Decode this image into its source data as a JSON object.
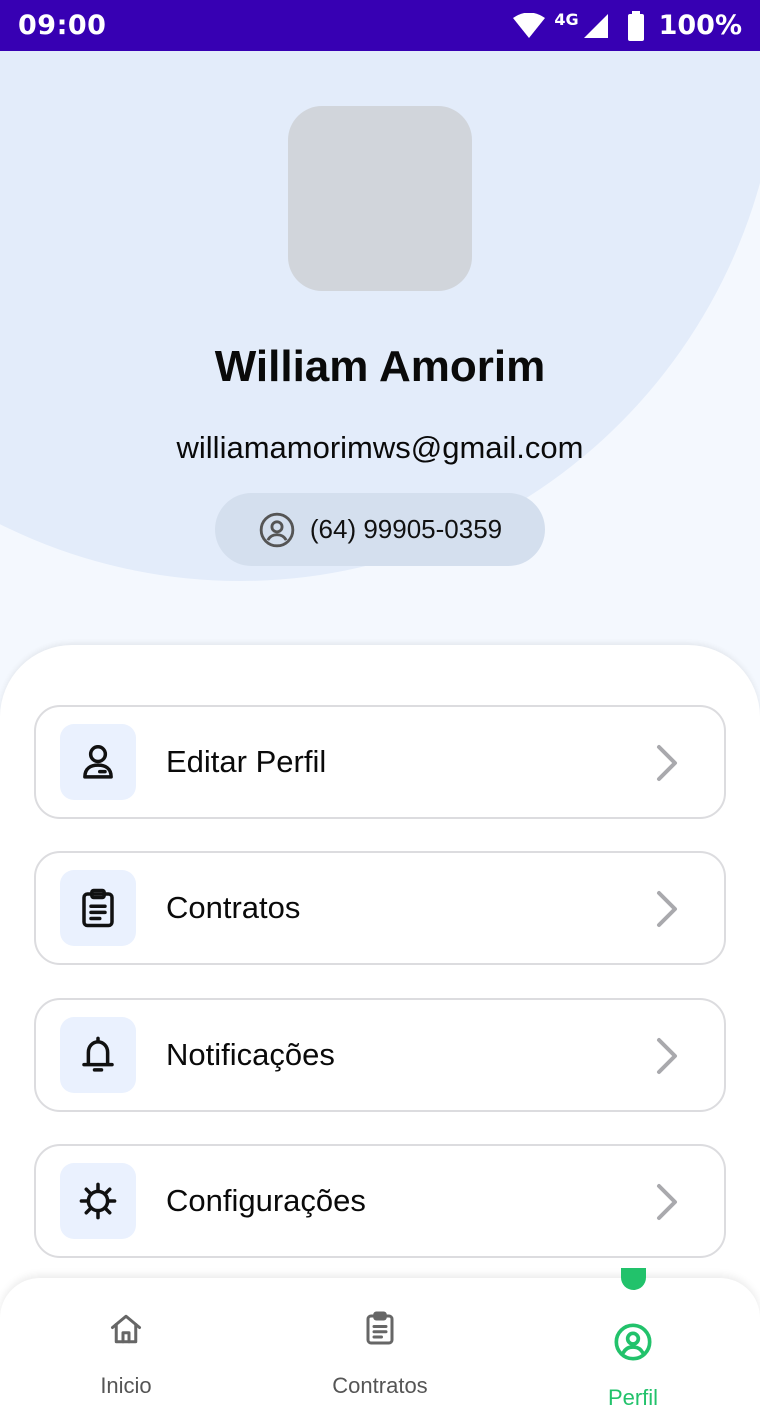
{
  "status_bar": {
    "time": "09:00",
    "network": "4G",
    "battery": "100%"
  },
  "profile": {
    "name": "William Amorim",
    "email": "williamamorimws@gmail.com",
    "phone": "(64) 99905-0359"
  },
  "menu": {
    "items": [
      {
        "label": "Editar Perfil",
        "icon": "user-icon"
      },
      {
        "label": "Contratos",
        "icon": "clipboard-icon"
      },
      {
        "label": "Notificações",
        "icon": "bell-icon"
      },
      {
        "label": "Configurações",
        "icon": "gear-icon"
      }
    ]
  },
  "bottom_nav": {
    "items": [
      {
        "label": "Inicio",
        "icon": "home-icon"
      },
      {
        "label": "Contratos",
        "icon": "clipboard-icon"
      },
      {
        "label": "Perfil",
        "icon": "user-circle-icon"
      }
    ],
    "active_index": 2,
    "active_color": "#22c26b"
  },
  "colors": {
    "status_bar": "#3700b3",
    "accent": "#22c26b",
    "icon_bg": "#eaf1fe"
  }
}
